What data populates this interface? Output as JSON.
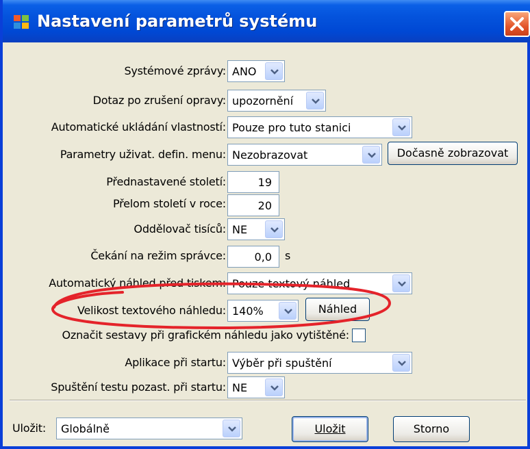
{
  "window": {
    "title": "Nastavení parametrů systému"
  },
  "rows": [
    {
      "label": "Systémové zprávy:",
      "value": "ANO"
    },
    {
      "label": "Dotaz po zrušení opravy:",
      "value": "upozornění"
    },
    {
      "label": "Automatické ukládání vlastností:",
      "value": "Pouze pro tuto stanici"
    },
    {
      "label": "Parametry uživat. defin. menu:",
      "value": "Nezobrazovat",
      "button": "Dočasně zobrazovat"
    },
    {
      "label": "Přednastavené století:",
      "value": "19"
    },
    {
      "label": "Přelom století v roce:",
      "value": "20"
    },
    {
      "label": "Oddělovač tisíců:",
      "value": "NE"
    },
    {
      "label": "Čekání na režim správce:",
      "value": "0,0",
      "unit": "s"
    },
    {
      "label": "Automatický náhled před tiskem:",
      "value": "Pouze textový náhled"
    },
    {
      "label": "Velikost textového náhledu:",
      "value": "140%",
      "button": "Náhled"
    },
    {
      "label": "Označit sestavy při grafickém náhledu jako vytištěné:"
    },
    {
      "label": "Aplikace při startu:",
      "value": "Výběr při spuštění"
    },
    {
      "label": "Spuštění testu pozast. při startu:",
      "value": "NE"
    }
  ],
  "footer": {
    "save_label": "Uložit:",
    "save_value": "Globálně",
    "ok_button": "Uložit",
    "cancel_button": "Storno"
  },
  "colors": {
    "title_bar": "#0453DC",
    "highlight": "#E4232A",
    "dialog_bg": "#ECE9D8"
  }
}
